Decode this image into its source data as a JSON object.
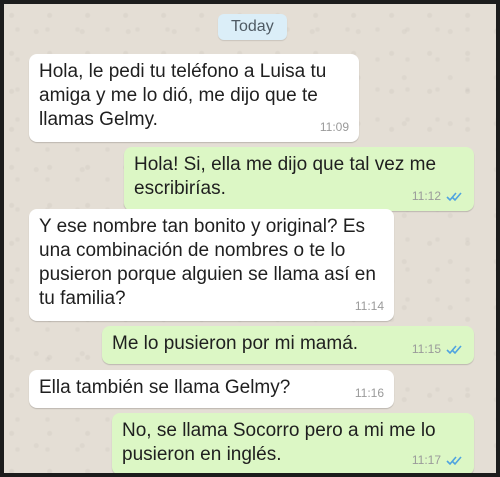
{
  "chat": {
    "date_label": "Today",
    "messages": [
      {
        "direction": "incoming",
        "text": "Hola, le pedi tu teléfono a Luisa tu amiga y me lo dió, me dijo que te llamas Gelmy.",
        "time": "11:09"
      },
      {
        "direction": "outgoing",
        "text": "Hola! Si, ella me dijo que tal vez me escribirías.",
        "time": "11:12",
        "read_receipt": "double-check-icon"
      },
      {
        "direction": "incoming",
        "text": "Y ese nombre tan bonito y original? Es una combinación de nombres o te lo pusieron porque alguien se llama así en tu familia?",
        "time": "11:14"
      },
      {
        "direction": "outgoing",
        "text": "Me lo pusieron por mi mamá.",
        "time": "11:15",
        "read_receipt": "double-check-icon"
      },
      {
        "direction": "incoming",
        "text": "Ella también se llama Gelmy?",
        "time": "11:16"
      },
      {
        "direction": "outgoing",
        "text": "No, se llama Socorro pero a mi me lo pusieron en inglés.",
        "time": "11:17",
        "read_receipt": "double-check-icon"
      }
    ]
  },
  "colors": {
    "incoming_bubble": "#ffffff",
    "outgoing_bubble": "#dcf7c5",
    "read_tick": "#4fa3e0",
    "chat_background": "#e4ded5"
  }
}
